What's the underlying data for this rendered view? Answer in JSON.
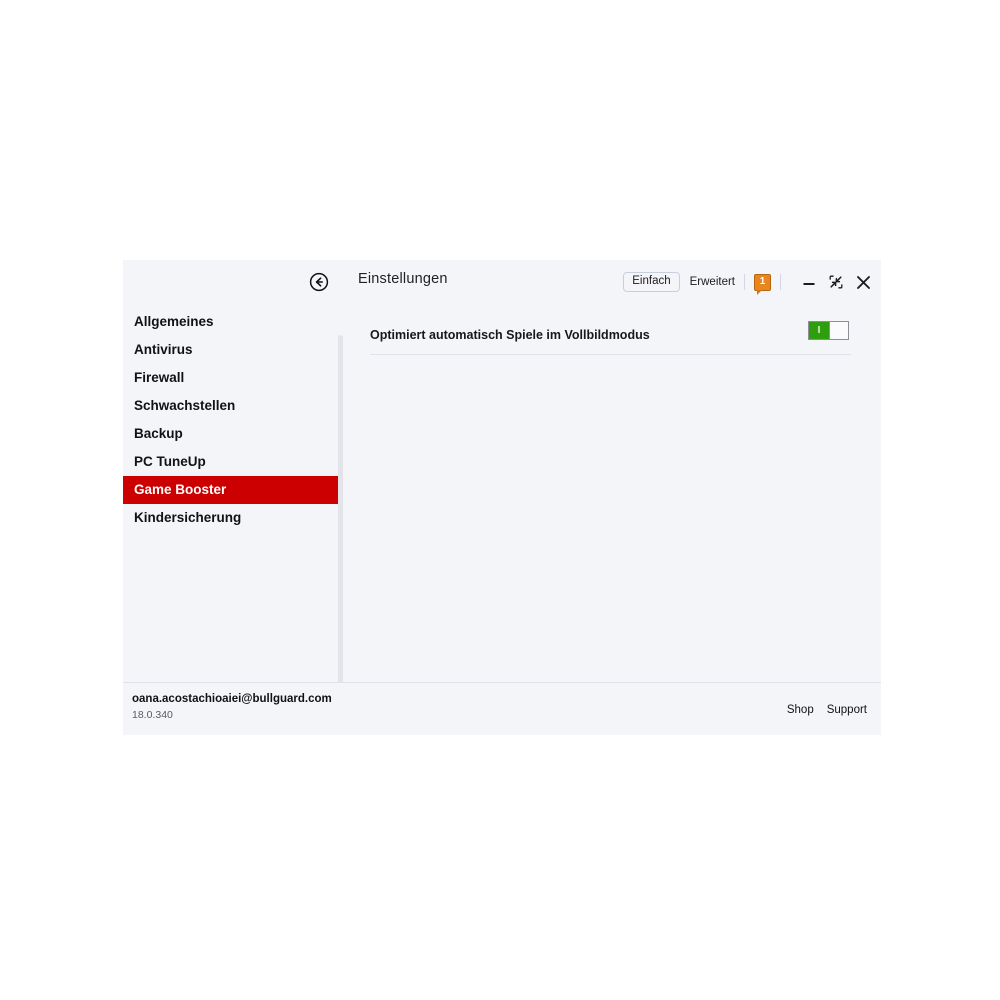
{
  "window": {
    "title": "Einstellungen",
    "back_icon": "back-circle-arrow-icon"
  },
  "header": {
    "mode_simple": "Einfach",
    "mode_advanced": "Erweitert",
    "notification_count": "1",
    "minimize_icon": "minimize-icon",
    "restore_icon": "restore-down-icon",
    "close_icon": "close-icon"
  },
  "sidebar": {
    "items": [
      {
        "label": "Allgemeines",
        "selected": false
      },
      {
        "label": "Antivirus",
        "selected": false
      },
      {
        "label": "Firewall",
        "selected": false
      },
      {
        "label": "Schwachstellen",
        "selected": false
      },
      {
        "label": "Backup",
        "selected": false
      },
      {
        "label": "PC TuneUp",
        "selected": false
      },
      {
        "label": "Game Booster",
        "selected": true
      },
      {
        "label": "Kindersicherung",
        "selected": false
      }
    ]
  },
  "content": {
    "settings": [
      {
        "label": "Optimiert automatisch Spiele im Vollbildmodus",
        "toggle_state": "on",
        "toggle_on_mark": "I"
      }
    ]
  },
  "footer": {
    "email": "oana.acostachioaiei@bullguard.com",
    "version": "18.0.340",
    "shop_label": "Shop",
    "support_label": "Support"
  },
  "colors": {
    "accent_selected": "#cc0000",
    "toggle_on": "#2f9e0e",
    "badge": "#e8861d",
    "window_bg": "#f4f5f8"
  }
}
